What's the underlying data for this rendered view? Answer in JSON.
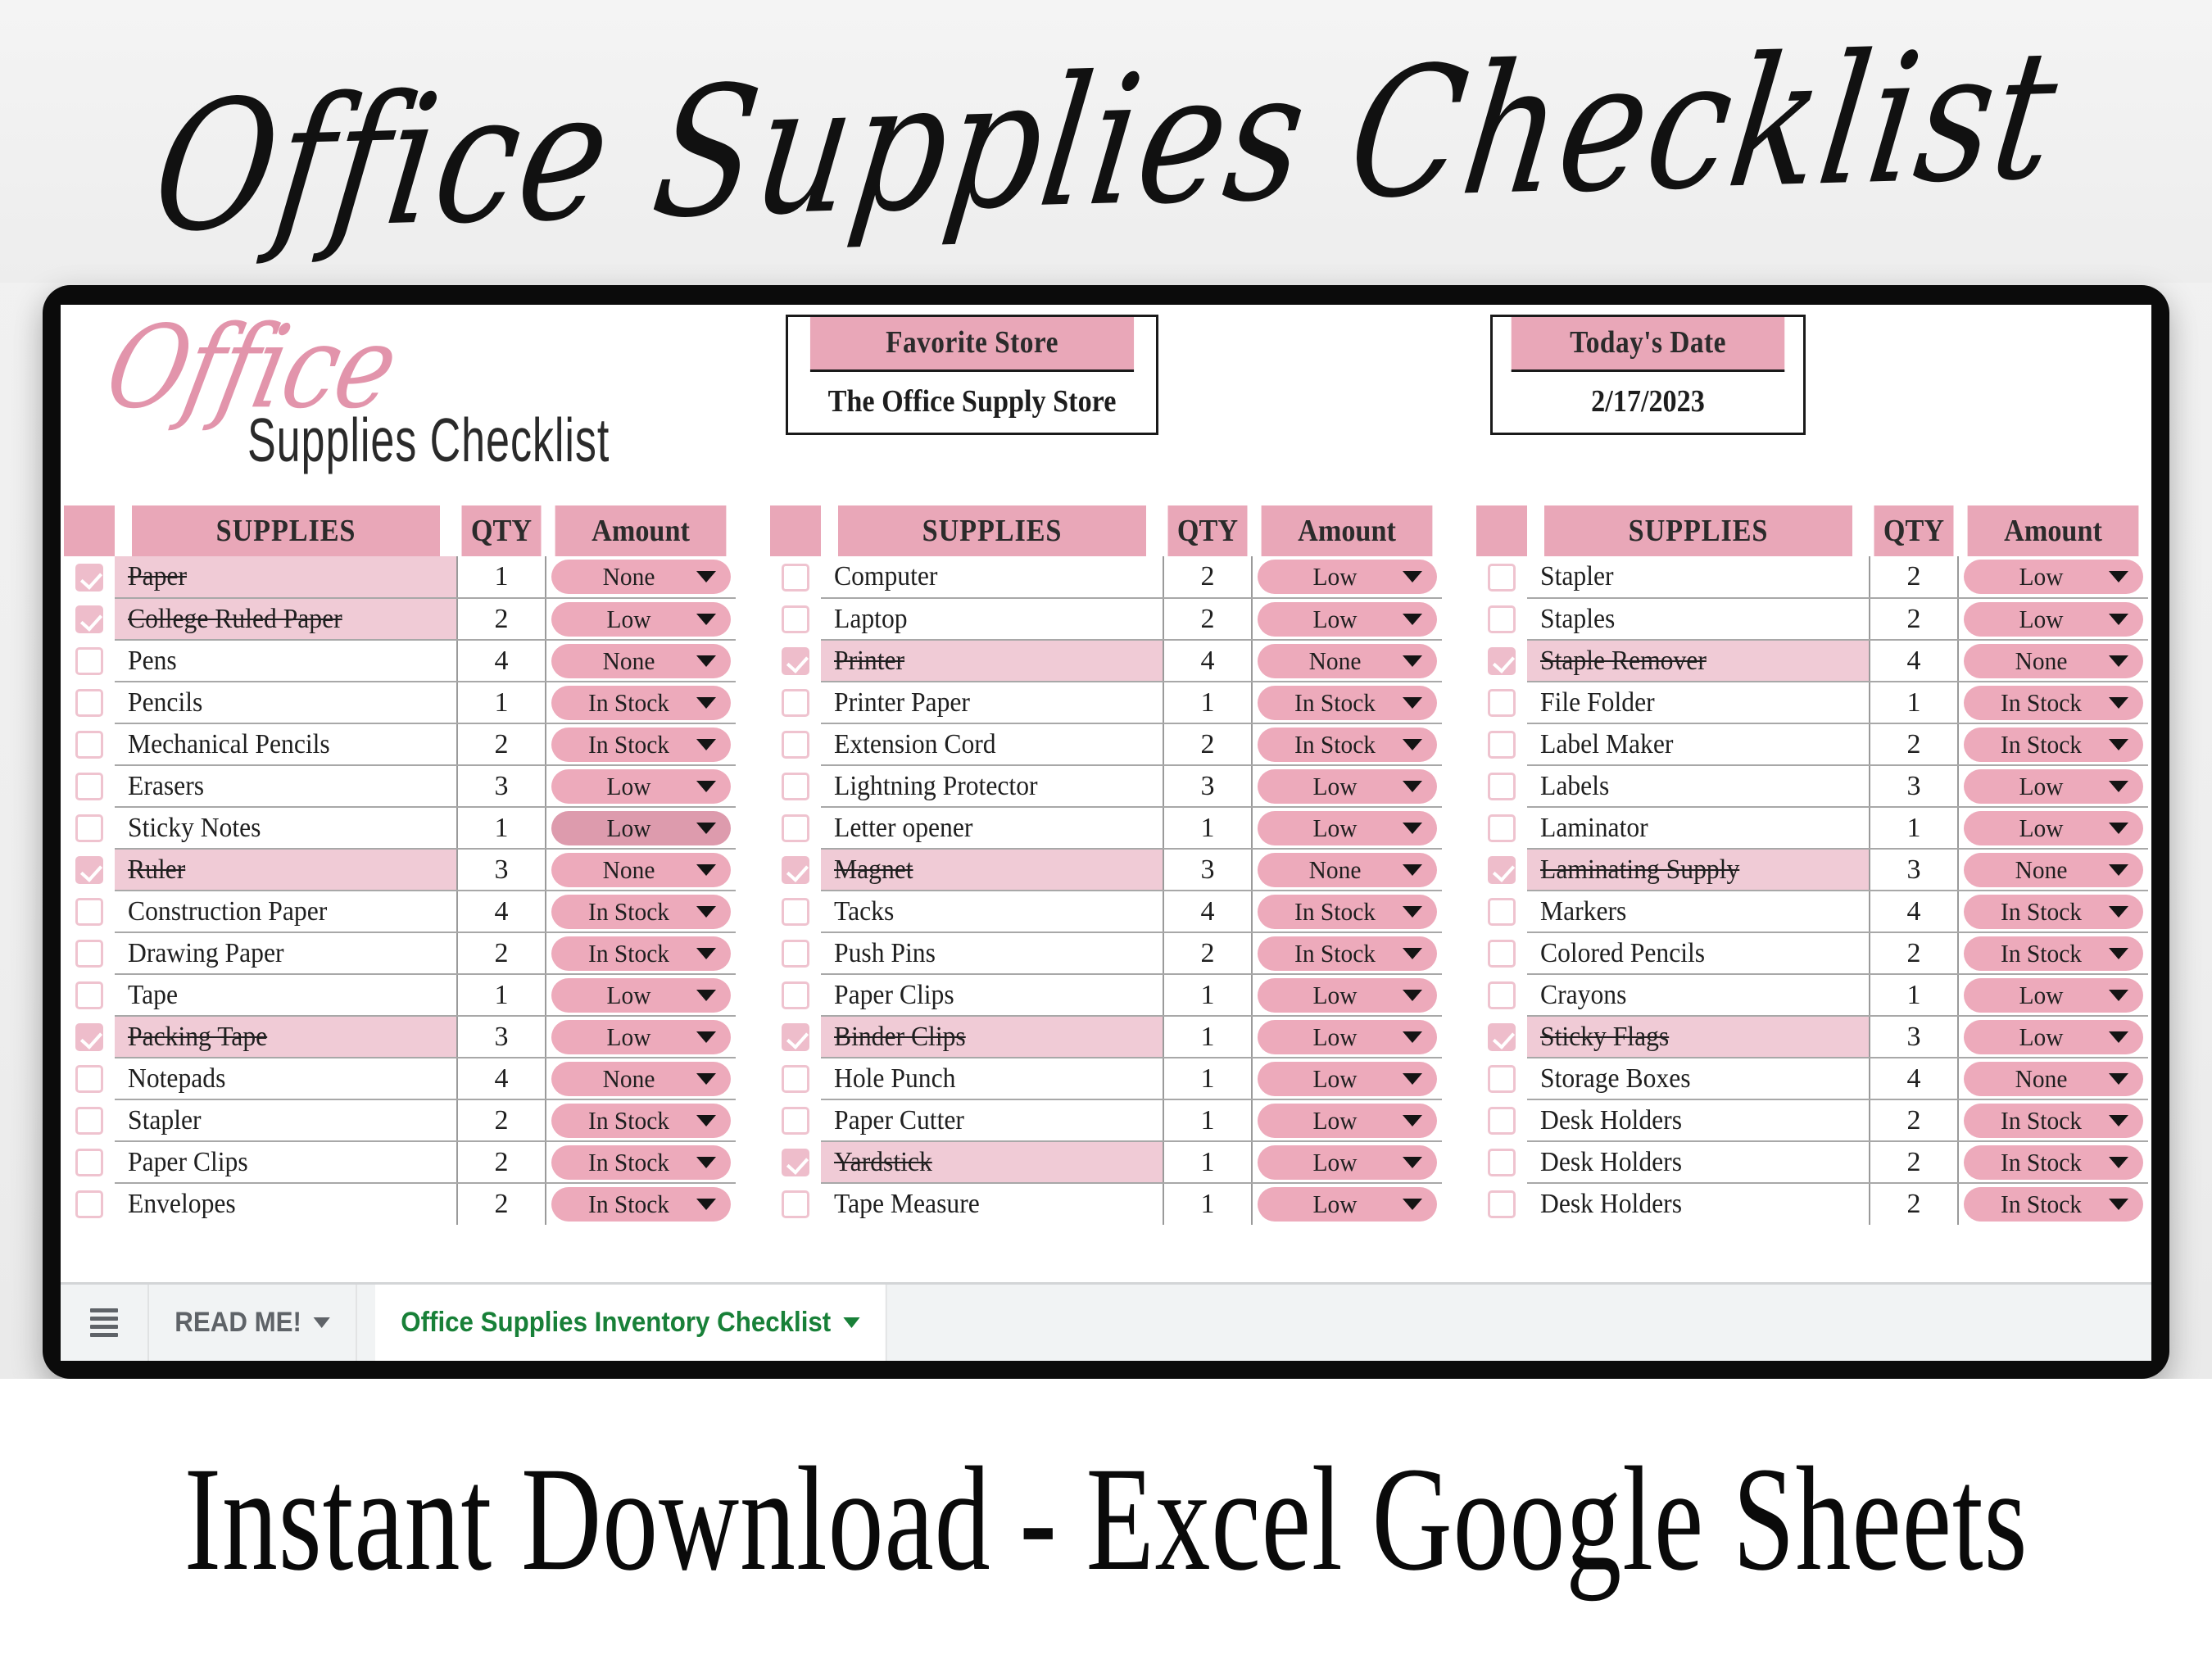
{
  "page": {
    "top_title": "Office Supplies Checklist",
    "bottom_caption": "Instant Download - Excel Google Sheets"
  },
  "sheet": {
    "logo": {
      "script_word": "Office",
      "sub_word": "Supplies Checklist"
    },
    "favorite_store": {
      "label": "Favorite Store",
      "value": "The Office Supply Store"
    },
    "todays_date": {
      "label": "Today's Date",
      "value": "2/17/2023"
    },
    "columns": {
      "supplies": "SUPPLIES",
      "qty": "QTY",
      "amount": "Amount"
    },
    "colors": {
      "header_pink": "#e9a7b8",
      "row_done_pink": "#f0cbd6",
      "pill_pink": "#edaabb",
      "pill_pink_dark": "#dd9bad",
      "checkbox_border": "#efc3cf",
      "logo_pink": "#e294ab",
      "active_tab_green": "#188038"
    },
    "tables": [
      {
        "id": "table-1",
        "rows": [
          {
            "checked": true,
            "name": "Paper",
            "qty": "1",
            "amount": "None",
            "pill_state": "normal"
          },
          {
            "checked": true,
            "name": "College Ruled Paper",
            "qty": "2",
            "amount": "Low",
            "pill_state": "normal"
          },
          {
            "checked": false,
            "name": "Pens",
            "qty": "4",
            "amount": "None",
            "pill_state": "normal"
          },
          {
            "checked": false,
            "name": "Pencils",
            "qty": "1",
            "amount": "In Stock",
            "pill_state": "normal"
          },
          {
            "checked": false,
            "name": "Mechanical Pencils",
            "qty": "2",
            "amount": "In Stock",
            "pill_state": "normal"
          },
          {
            "checked": false,
            "name": "Erasers",
            "qty": "3",
            "amount": "Low",
            "pill_state": "normal"
          },
          {
            "checked": false,
            "name": "Sticky Notes",
            "qty": "1",
            "amount": "Low",
            "pill_state": "dark"
          },
          {
            "checked": true,
            "name": "Ruler",
            "qty": "3",
            "amount": "None",
            "pill_state": "normal"
          },
          {
            "checked": false,
            "name": "Construction Paper",
            "qty": "4",
            "amount": "In Stock",
            "pill_state": "normal"
          },
          {
            "checked": false,
            "name": "Drawing Paper",
            "qty": "2",
            "amount": "In Stock",
            "pill_state": "normal"
          },
          {
            "checked": false,
            "name": "Tape",
            "qty": "1",
            "amount": "Low",
            "pill_state": "normal"
          },
          {
            "checked": true,
            "name": "Packing Tape",
            "qty": "3",
            "amount": "Low",
            "pill_state": "normal"
          },
          {
            "checked": false,
            "name": "Notepads",
            "qty": "4",
            "amount": "None",
            "pill_state": "normal"
          },
          {
            "checked": false,
            "name": "Stapler",
            "qty": "2",
            "amount": "In Stock",
            "pill_state": "normal"
          },
          {
            "checked": false,
            "name": "Paper Clips",
            "qty": "2",
            "amount": "In Stock",
            "pill_state": "normal"
          },
          {
            "checked": false,
            "name": "Envelopes",
            "qty": "2",
            "amount": "In Stock",
            "pill_state": "normal"
          }
        ]
      },
      {
        "id": "table-2",
        "rows": [
          {
            "checked": false,
            "name": "Computer",
            "qty": "2",
            "amount": "Low",
            "pill_state": "normal"
          },
          {
            "checked": false,
            "name": "Laptop",
            "qty": "2",
            "amount": "Low",
            "pill_state": "normal"
          },
          {
            "checked": true,
            "name": "Printer",
            "qty": "4",
            "amount": "None",
            "pill_state": "normal"
          },
          {
            "checked": false,
            "name": "Printer Paper",
            "qty": "1",
            "amount": "In Stock",
            "pill_state": "normal"
          },
          {
            "checked": false,
            "name": "Extension Cord",
            "qty": "2",
            "amount": "In Stock",
            "pill_state": "normal"
          },
          {
            "checked": false,
            "name": "Lightning Protector",
            "qty": "3",
            "amount": "Low",
            "pill_state": "normal"
          },
          {
            "checked": false,
            "name": "Letter opener",
            "qty": "1",
            "amount": "Low",
            "pill_state": "normal"
          },
          {
            "checked": true,
            "name": "Magnet",
            "qty": "3",
            "amount": "None",
            "pill_state": "normal"
          },
          {
            "checked": false,
            "name": "Tacks",
            "qty": "4",
            "amount": "In Stock",
            "pill_state": "normal"
          },
          {
            "checked": false,
            "name": "Push Pins",
            "qty": "2",
            "amount": "In Stock",
            "pill_state": "normal"
          },
          {
            "checked": false,
            "name": "Paper Clips",
            "qty": "1",
            "amount": "Low",
            "pill_state": "normal"
          },
          {
            "checked": true,
            "name": "Binder Clips",
            "qty": "1",
            "amount": "Low",
            "pill_state": "normal"
          },
          {
            "checked": false,
            "name": "Hole Punch",
            "qty": "1",
            "amount": "Low",
            "pill_state": "normal"
          },
          {
            "checked": false,
            "name": "Paper Cutter",
            "qty": "1",
            "amount": "Low",
            "pill_state": "normal"
          },
          {
            "checked": true,
            "name": "Yardstick",
            "qty": "1",
            "amount": "Low",
            "pill_state": "normal"
          },
          {
            "checked": false,
            "name": "Tape Measure",
            "qty": "1",
            "amount": "Low",
            "pill_state": "normal"
          }
        ]
      },
      {
        "id": "table-3",
        "rows": [
          {
            "checked": false,
            "name": "Stapler",
            "qty": "2",
            "amount": "Low",
            "pill_state": "normal"
          },
          {
            "checked": false,
            "name": "Staples",
            "qty": "2",
            "amount": "Low",
            "pill_state": "normal"
          },
          {
            "checked": true,
            "name": "Staple Remover",
            "qty": "4",
            "amount": "None",
            "pill_state": "normal"
          },
          {
            "checked": false,
            "name": "File Folder",
            "qty": "1",
            "amount": "In Stock",
            "pill_state": "normal"
          },
          {
            "checked": false,
            "name": "Label Maker",
            "qty": "2",
            "amount": "In Stock",
            "pill_state": "normal"
          },
          {
            "checked": false,
            "name": "Labels",
            "qty": "3",
            "amount": "Low",
            "pill_state": "normal"
          },
          {
            "checked": false,
            "name": "Laminator",
            "qty": "1",
            "amount": "Low",
            "pill_state": "normal"
          },
          {
            "checked": true,
            "name": "Laminating Supply",
            "qty": "3",
            "amount": "None",
            "pill_state": "normal"
          },
          {
            "checked": false,
            "name": "Markers",
            "qty": "4",
            "amount": "In Stock",
            "pill_state": "normal"
          },
          {
            "checked": false,
            "name": "Colored Pencils",
            "qty": "2",
            "amount": "In Stock",
            "pill_state": "normal"
          },
          {
            "checked": false,
            "name": "Crayons",
            "qty": "1",
            "amount": "Low",
            "pill_state": "normal"
          },
          {
            "checked": true,
            "name": "Sticky Flags",
            "qty": "3",
            "amount": "Low",
            "pill_state": "normal"
          },
          {
            "checked": false,
            "name": "Storage Boxes",
            "qty": "4",
            "amount": "None",
            "pill_state": "normal"
          },
          {
            "checked": false,
            "name": "Desk Holders",
            "qty": "2",
            "amount": "In Stock",
            "pill_state": "normal"
          },
          {
            "checked": false,
            "name": "Desk Holders",
            "qty": "2",
            "amount": "In Stock",
            "pill_state": "normal"
          },
          {
            "checked": false,
            "name": "Desk Holders",
            "qty": "2",
            "amount": "In Stock",
            "pill_state": "normal"
          }
        ]
      }
    ],
    "tab_bar": {
      "all_sheets_label": "All sheets",
      "tabs": [
        {
          "label": "READ ME!",
          "active": false
        },
        {
          "label": "Office Supplies Inventory Checklist",
          "active": true
        }
      ]
    }
  }
}
